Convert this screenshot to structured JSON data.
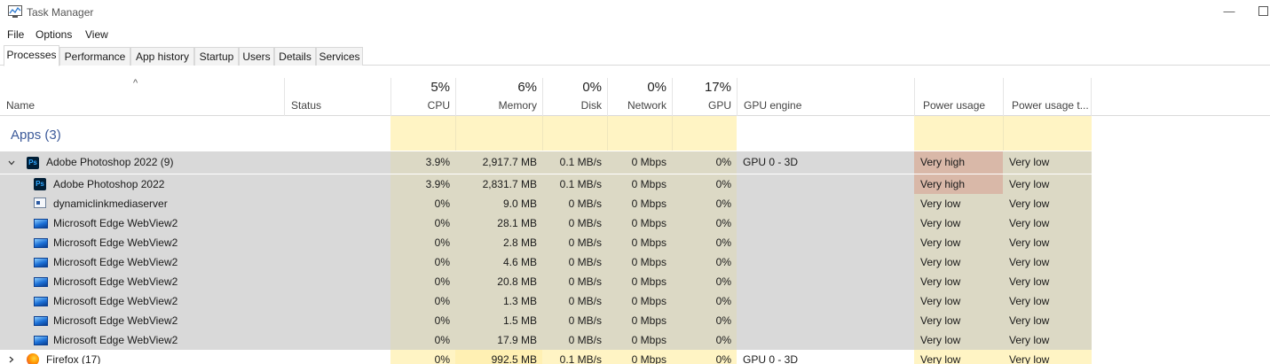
{
  "window": {
    "title": "Task Manager",
    "minimize_glyph": "—"
  },
  "menu": [
    "File",
    "Options",
    "View"
  ],
  "tabs": [
    {
      "label": "Processes",
      "active": true
    },
    {
      "label": "Performance",
      "active": false
    },
    {
      "label": "App history",
      "active": false
    },
    {
      "label": "Startup",
      "active": false
    },
    {
      "label": "Users",
      "active": false
    },
    {
      "label": "Details",
      "active": false
    },
    {
      "label": "Services",
      "active": false
    }
  ],
  "columns": {
    "name": "Name",
    "status": "Status",
    "cpu": {
      "pct": "5%",
      "label": "CPU"
    },
    "memory": {
      "pct": "6%",
      "label": "Memory"
    },
    "disk": {
      "pct": "0%",
      "label": "Disk"
    },
    "network": {
      "pct": "0%",
      "label": "Network"
    },
    "gpu": {
      "pct": "17%",
      "label": "GPU"
    },
    "gpu_engine": "GPU engine",
    "power": "Power usage",
    "power_trend": "Power usage t..."
  },
  "group_label": "Apps (3)",
  "colors": {
    "heat_light": "#fff4c4",
    "heat_medium": "#fff0b3",
    "selected_bg": "#d9d9d9",
    "selected_heat": "#dcd9c5",
    "power_high": "#d9b8a8",
    "group_text": "#3c5a9a"
  },
  "rows": [
    {
      "icon": "photoshop-icon",
      "name": "Adobe Photoshop 2022 (9)",
      "expander": "expanded",
      "indent": 0,
      "cpu": "3.9%",
      "memory": "2,917.7 MB",
      "disk": "0.1 MB/s",
      "network": "0 Mbps",
      "gpu": "0%",
      "gpu_engine": "GPU 0 - 3D",
      "power": "Very high",
      "power_trend": "Very low",
      "selected": true
    },
    {
      "icon": "photoshop-icon",
      "name": "Adobe Photoshop 2022",
      "indent": 1,
      "cpu": "3.9%",
      "memory": "2,831.7 MB",
      "disk": "0.1 MB/s",
      "network": "0 Mbps",
      "gpu": "0%",
      "gpu_engine": "",
      "power": "Very high",
      "power_trend": "Very low",
      "selected": true
    },
    {
      "icon": "window-app-icon",
      "name": "dynamiclinkmediaserver",
      "indent": 1,
      "cpu": "0%",
      "memory": "9.0 MB",
      "disk": "0 MB/s",
      "network": "0 Mbps",
      "gpu": "0%",
      "gpu_engine": "",
      "power": "Very low",
      "power_trend": "Very low",
      "selected": true
    },
    {
      "icon": "edge-webview-icon",
      "name": "Microsoft Edge WebView2",
      "indent": 1,
      "cpu": "0%",
      "memory": "28.1 MB",
      "disk": "0 MB/s",
      "network": "0 Mbps",
      "gpu": "0%",
      "gpu_engine": "",
      "power": "Very low",
      "power_trend": "Very low",
      "selected": true
    },
    {
      "icon": "edge-webview-icon",
      "name": "Microsoft Edge WebView2",
      "indent": 1,
      "cpu": "0%",
      "memory": "2.8 MB",
      "disk": "0 MB/s",
      "network": "0 Mbps",
      "gpu": "0%",
      "gpu_engine": "",
      "power": "Very low",
      "power_trend": "Very low",
      "selected": true
    },
    {
      "icon": "edge-webview-icon",
      "name": "Microsoft Edge WebView2",
      "indent": 1,
      "cpu": "0%",
      "memory": "4.6 MB",
      "disk": "0 MB/s",
      "network": "0 Mbps",
      "gpu": "0%",
      "gpu_engine": "",
      "power": "Very low",
      "power_trend": "Very low",
      "selected": true
    },
    {
      "icon": "edge-webview-icon",
      "name": "Microsoft Edge WebView2",
      "indent": 1,
      "cpu": "0%",
      "memory": "20.8 MB",
      "disk": "0 MB/s",
      "network": "0 Mbps",
      "gpu": "0%",
      "gpu_engine": "",
      "power": "Very low",
      "power_trend": "Very low",
      "selected": true
    },
    {
      "icon": "edge-webview-icon",
      "name": "Microsoft Edge WebView2",
      "indent": 1,
      "cpu": "0%",
      "memory": "1.3 MB",
      "disk": "0 MB/s",
      "network": "0 Mbps",
      "gpu": "0%",
      "gpu_engine": "",
      "power": "Very low",
      "power_trend": "Very low",
      "selected": true
    },
    {
      "icon": "edge-webview-icon",
      "name": "Microsoft Edge WebView2",
      "indent": 1,
      "cpu": "0%",
      "memory": "1.5 MB",
      "disk": "0 MB/s",
      "network": "0 Mbps",
      "gpu": "0%",
      "gpu_engine": "",
      "power": "Very low",
      "power_trend": "Very low",
      "selected": true
    },
    {
      "icon": "edge-webview-icon",
      "name": "Microsoft Edge WebView2",
      "indent": 1,
      "cpu": "0%",
      "memory": "17.9 MB",
      "disk": "0 MB/s",
      "network": "0 Mbps",
      "gpu": "0%",
      "gpu_engine": "",
      "power": "Very low",
      "power_trend": "Very low",
      "selected": true
    },
    {
      "icon": "firefox-icon",
      "name": "Firefox (17)",
      "expander": "collapsed",
      "indent": 0,
      "cpu": "0%",
      "memory": "992.5 MB",
      "disk": "0.1 MB/s",
      "network": "0 Mbps",
      "gpu": "0%",
      "gpu_engine": "GPU 0 - 3D",
      "power": "Very low",
      "power_trend": "Very low",
      "selected": false
    }
  ]
}
